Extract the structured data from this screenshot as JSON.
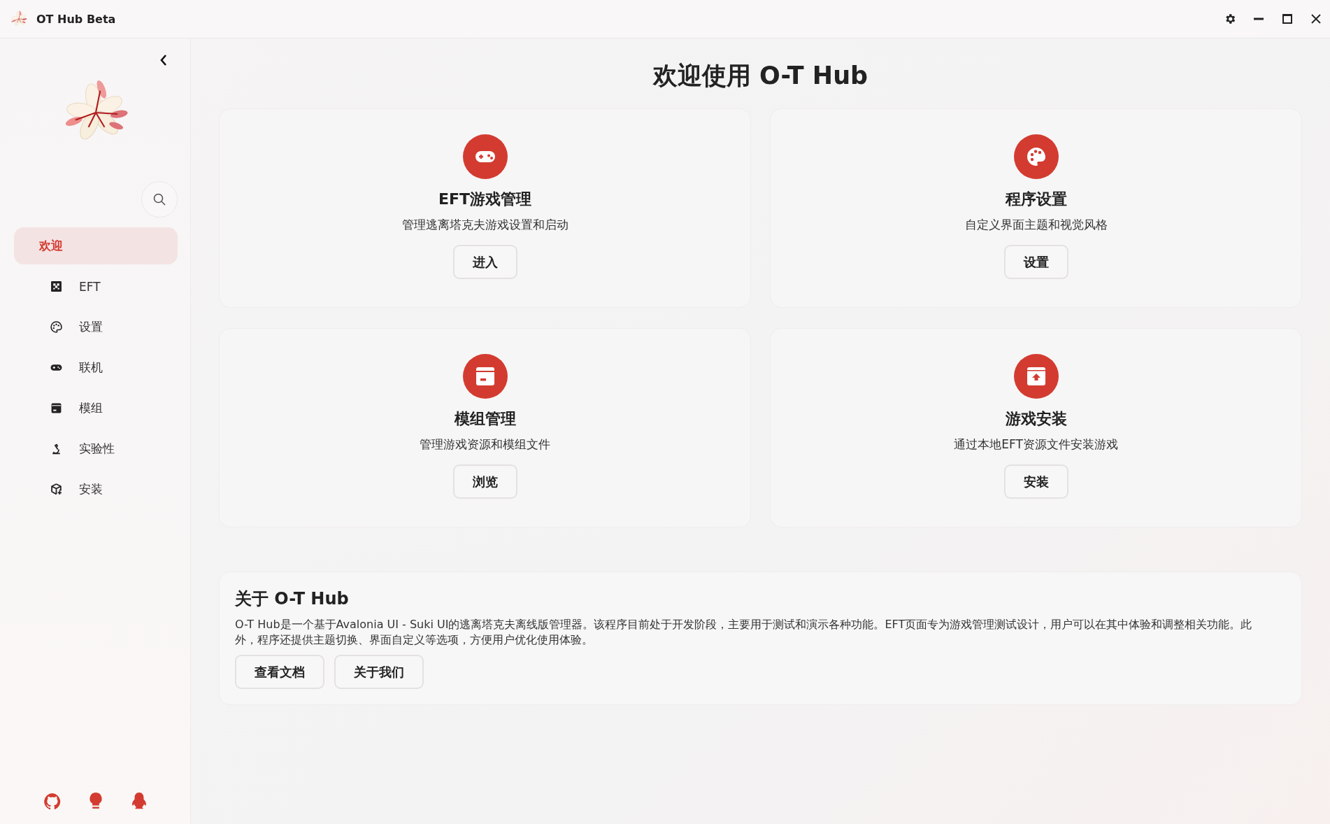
{
  "window": {
    "title": "OT Hub Beta"
  },
  "sidebar": {
    "items": [
      {
        "label": "欢迎",
        "selected": true
      },
      {
        "label": "EFT",
        "selected": false
      },
      {
        "label": "设置",
        "selected": false
      },
      {
        "label": "联机",
        "selected": false
      },
      {
        "label": "模组",
        "selected": false
      },
      {
        "label": "实验性",
        "selected": false
      },
      {
        "label": "安装",
        "selected": false
      }
    ]
  },
  "heading": "欢迎使用 O-T Hub",
  "cards": [
    {
      "title": "EFT游戏管理",
      "description": "管理逃离塔克夫游戏设置和启动",
      "button": "进入"
    },
    {
      "title": "程序设置",
      "description": "自定义界面主题和视觉风格",
      "button": "设置"
    },
    {
      "title": "模组管理",
      "description": "管理游戏资源和模组文件",
      "button": "浏览"
    },
    {
      "title": "游戏安装",
      "description": "通过本地EFT资源文件安装游戏",
      "button": "安装"
    }
  ],
  "about": {
    "title": "关于 O-T Hub",
    "text": "O-T Hub是一个基于Avalonia UI - Suki UI的逃离塔克夫离线版管理器。该程序目前处于开发阶段，主要用于测试和演示各种功能。EFT页面专为游戏管理测试设计，用户可以在其中体验和调整相关功能。此外，程序还提供主题切换、界面自定义等选项，方便用户优化使用体验。",
    "buttons": [
      "查看文档",
      "关于我们"
    ]
  }
}
